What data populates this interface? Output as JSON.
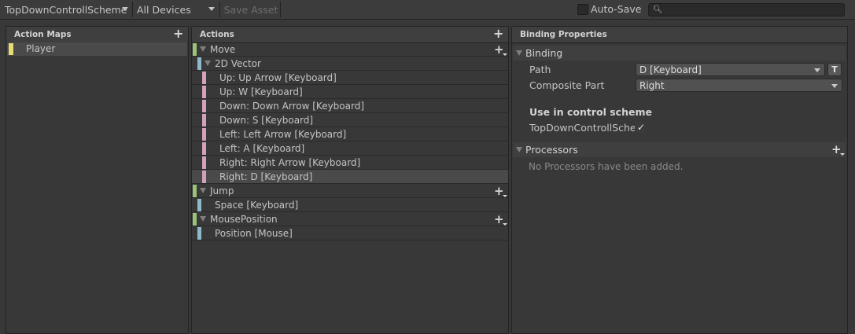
{
  "toolbar": {
    "control_scheme": "TopDownControllScheme",
    "devices": "All Devices",
    "save_label": "Save Asset",
    "autosave_label": "Auto-Save",
    "autosave_checked": false,
    "search_placeholder": ""
  },
  "action_maps": {
    "title": "Action Maps",
    "items": [
      {
        "label": "Player",
        "selected": true
      }
    ]
  },
  "actions": {
    "title": "Actions",
    "rows": [
      {
        "label": "Move",
        "kind": "action"
      },
      {
        "label": "2D Vector",
        "kind": "composite"
      },
      {
        "label": "Up: Up Arrow [Keyboard]",
        "kind": "part"
      },
      {
        "label": "Up: W [Keyboard]",
        "kind": "part"
      },
      {
        "label": "Down: Down Arrow [Keyboard]",
        "kind": "part"
      },
      {
        "label": "Down: S [Keyboard]",
        "kind": "part"
      },
      {
        "label": "Left: Left Arrow [Keyboard]",
        "kind": "part"
      },
      {
        "label": "Left: A [Keyboard]",
        "kind": "part"
      },
      {
        "label": "Right: Right Arrow [Keyboard]",
        "kind": "part"
      },
      {
        "label": "Right: D [Keyboard]",
        "kind": "part",
        "selected": true
      },
      {
        "label": "Jump",
        "kind": "action"
      },
      {
        "label": "Space [Keyboard]",
        "kind": "binding"
      },
      {
        "label": "MousePosition",
        "kind": "action"
      },
      {
        "label": "Position [Mouse]",
        "kind": "binding"
      }
    ]
  },
  "binding_properties": {
    "title": "Binding Properties",
    "binding_section": "Binding",
    "path_label": "Path",
    "path_value": "D [Keyboard]",
    "t_button": "T",
    "composite_part_label": "Composite Part",
    "composite_part_value": "Right",
    "use_in_scheme_heading": "Use in control scheme",
    "scheme_name": "TopDownControllSchen",
    "scheme_checked": true,
    "processors_section": "Processors",
    "processors_empty": "No Processors have been added."
  },
  "colors": {
    "action_bar": "#98c379",
    "binding_bar": "#8fb8c8",
    "composite_part_bar": "#d4a0bf",
    "map_bar": "#e6db74",
    "background": "#383838"
  }
}
